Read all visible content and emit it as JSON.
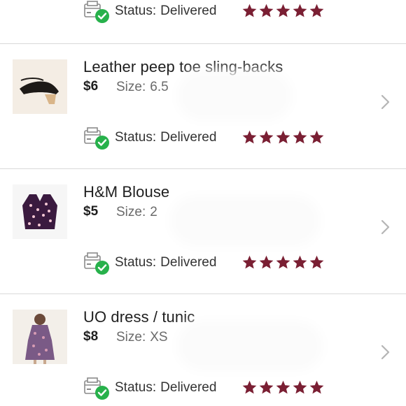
{
  "colors": {
    "star": "#7a1f33",
    "check_badge": "#27b14b",
    "chevron": "#b5b5b5",
    "divider": "#d9d9d9"
  },
  "items": [
    {
      "title": "",
      "price": "",
      "size_label": "",
      "size_value": "",
      "status_label": "Status:",
      "status_value": "Delivered",
      "rating": 5,
      "partial": true
    },
    {
      "title": "Leather peep toe sling-backs",
      "price": "$6",
      "size_label": "Size:",
      "size_value": "6.5",
      "status_label": "Status:",
      "status_value": "Delivered",
      "rating": 5
    },
    {
      "title": "H&M Blouse",
      "price": "$5",
      "size_label": "Size:",
      "size_value": "2",
      "status_label": "Status:",
      "status_value": "Delivered",
      "rating": 5
    },
    {
      "title": "UO dress / tunic",
      "price": "$8",
      "size_label": "Size:",
      "size_value": "XS",
      "status_label": "Status:",
      "status_value": "Delivered",
      "rating": 5
    }
  ],
  "icons": {
    "status": "package-delivered-icon",
    "rating": "star-icon",
    "navigate": "chevron-right-icon"
  }
}
